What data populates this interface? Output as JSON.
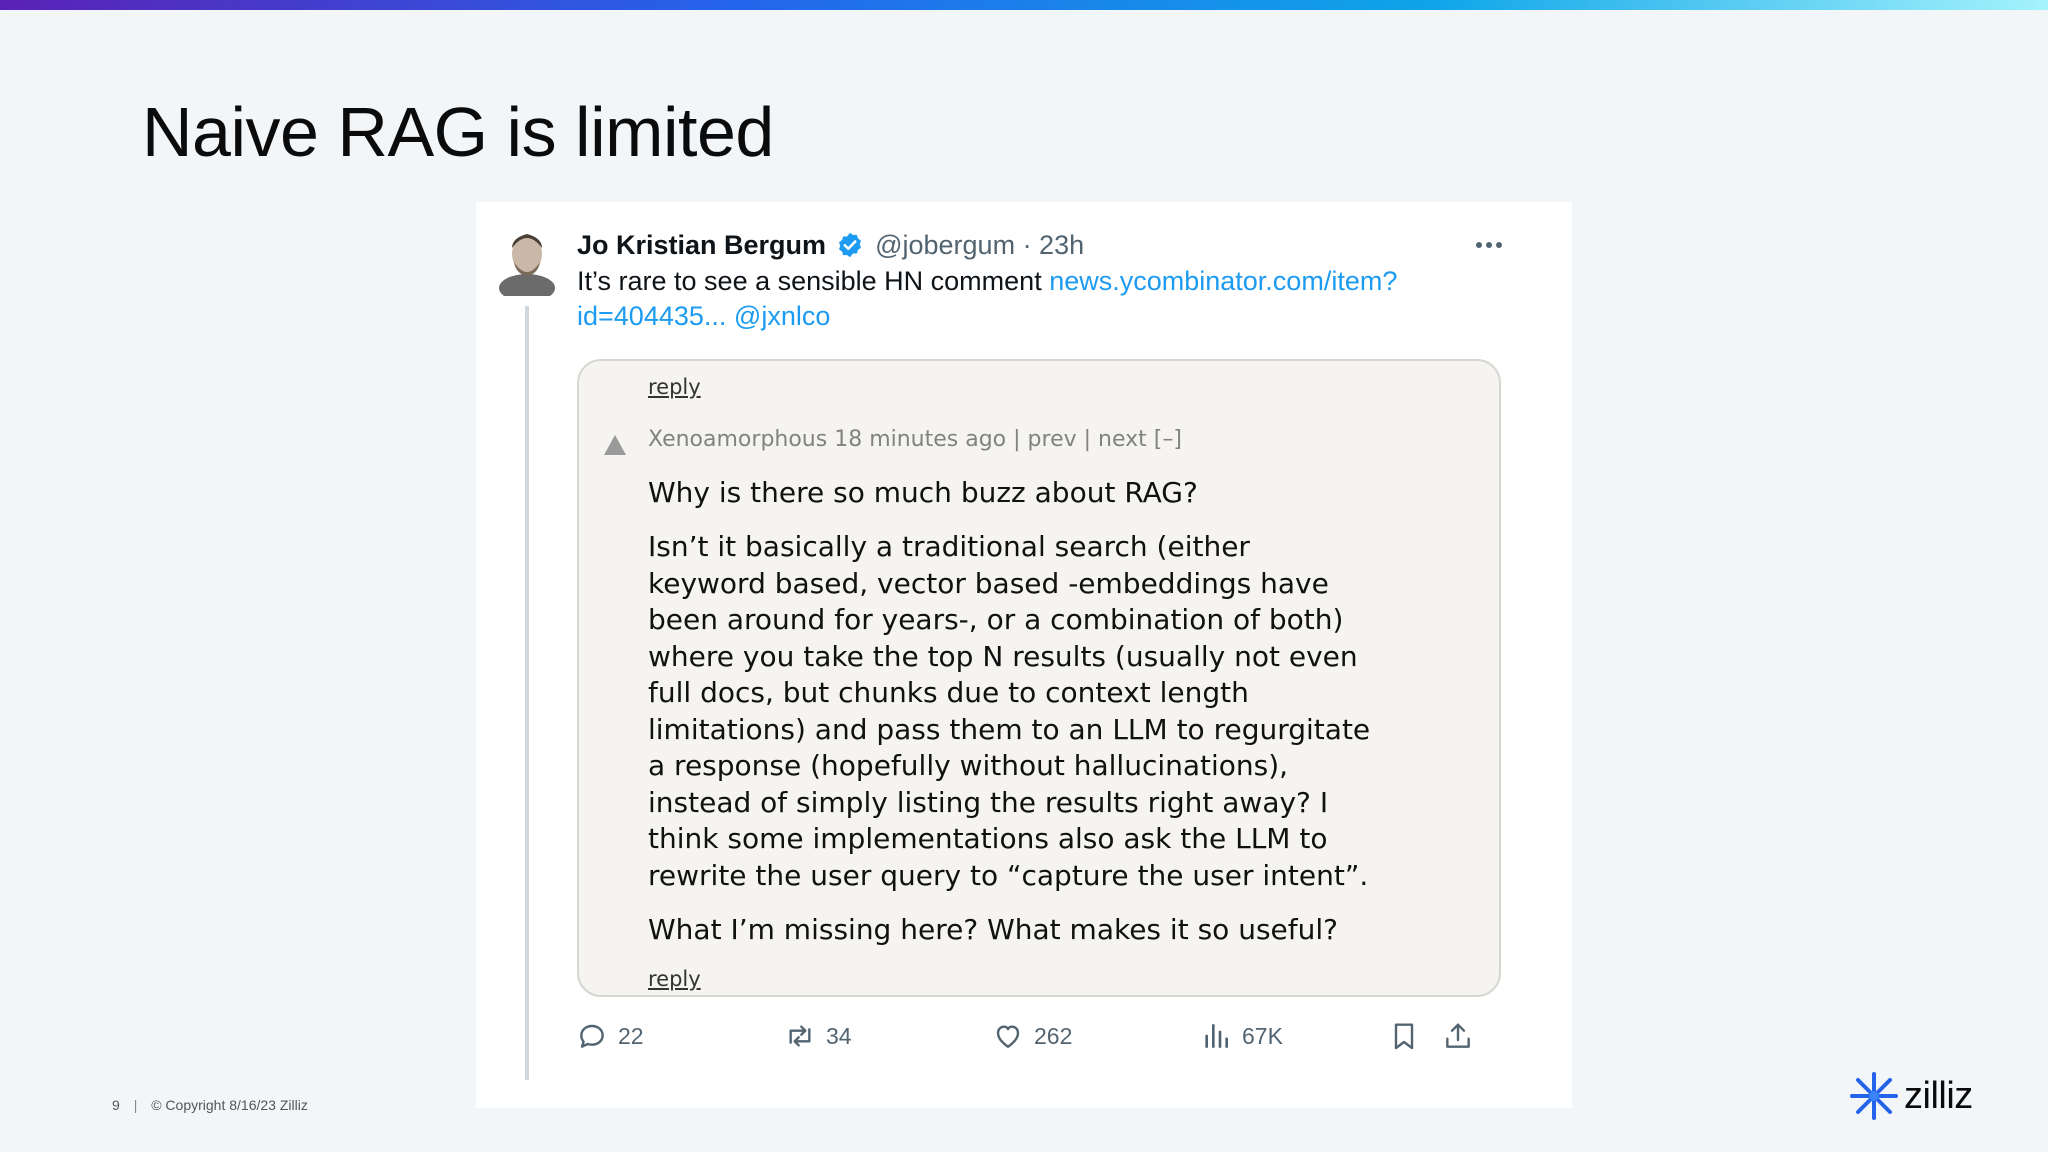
{
  "slide": {
    "title": "Naive RAG is limited"
  },
  "tweet": {
    "author_name": "Jo Kristian Bergum",
    "handle_time": "@jobergum · 23h",
    "text": "It’s rare to see a sensible HN comment ",
    "link_line1": "news.ycombinator.com/item?",
    "link_line2": "id=404435...",
    "mention": "@jxnlco",
    "stats": {
      "replies": "22",
      "retweets": "34",
      "likes": "262",
      "views": "67K"
    },
    "icons": [
      "verified-badge-icon",
      "more-options-icon",
      "reply-icon",
      "retweet-icon",
      "like-icon",
      "views-icon",
      "bookmark-icon",
      "share-icon"
    ]
  },
  "embed": {
    "reply_top": "reply",
    "meta": "Xenoamorphous 18 minutes ago | prev | next [–]",
    "question": "Why is there so much buzz about RAG?",
    "body_lines": [
      "Isn’t it basically a traditional search (either",
      "keyword based, vector based -embeddings have",
      "been around for years-, or a combination of both)",
      "where you take the top N results (usually not even",
      "full docs, but chunks due to context length",
      "limitations) and pass them to an LLM to regurgitate",
      "a response (hopefully without hallucinations),",
      "instead of simply listing the results right away? I",
      "think some implementations also ask the LLM to",
      "rewrite the user query to “capture the user intent”."
    ],
    "closing": "What I’m missing here? What makes it so useful?",
    "reply_bottom": "reply"
  },
  "footer": {
    "page_number": "9",
    "copyright": "© Copyright  8/16/23  Zilliz"
  },
  "logo": {
    "text": "zilliz"
  },
  "colors": {
    "accent_link": "#1d9bf0",
    "muted_text": "#536471",
    "embed_bg": "#f5f4f0",
    "logo_blue": "#2563eb"
  }
}
